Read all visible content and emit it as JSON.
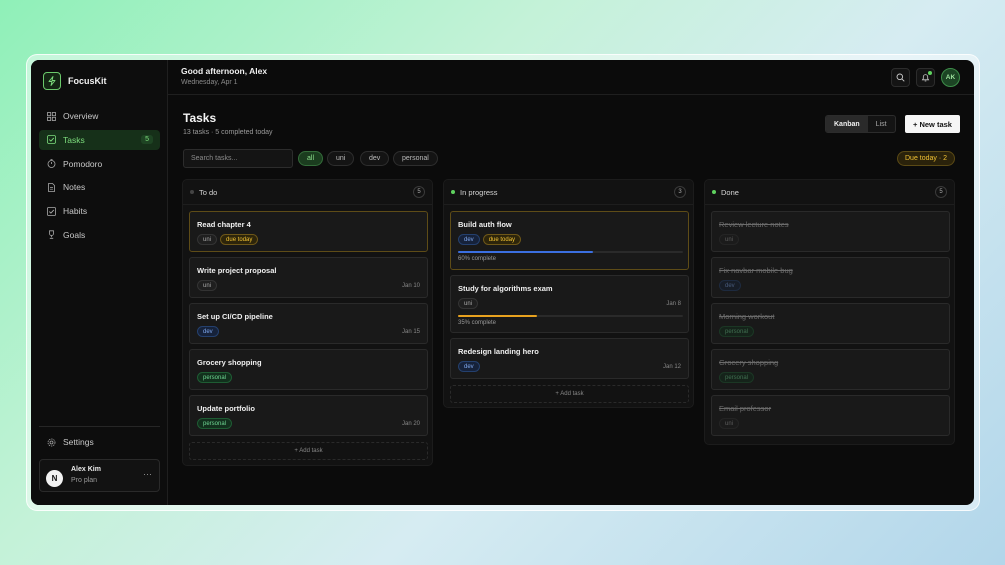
{
  "app": {
    "name": "FocusKit"
  },
  "sidebar": {
    "items": [
      {
        "label": "Overview",
        "icon": "grid-icon"
      },
      {
        "label": "Tasks",
        "icon": "checkbox-icon",
        "badge": "5",
        "active": true
      },
      {
        "label": "Pomodoro",
        "icon": "timer-icon"
      },
      {
        "label": "Notes",
        "icon": "document-icon"
      },
      {
        "label": "Habits",
        "icon": "check-square-icon"
      },
      {
        "label": "Goals",
        "icon": "trophy-icon"
      }
    ],
    "settings_label": "Settings",
    "user": {
      "initial": "N",
      "name": "Alex Kim",
      "plan": "Pro plan",
      "more": "···"
    }
  },
  "topbar": {
    "greeting": "Good afternoon, Alex",
    "date": "Wednesday, Apr 1",
    "avatar_initials": "AK"
  },
  "page": {
    "title": "Tasks",
    "subtitle": "13 tasks · 5 completed today",
    "views": [
      "Kanban",
      "List"
    ],
    "active_view": "Kanban",
    "new_task_label": "+ New task",
    "search_placeholder": "Search tasks...",
    "filters": [
      "all",
      "uni",
      "dev",
      "personal"
    ],
    "active_filter": "all",
    "due_today_label": "Due today · 2"
  },
  "columns": [
    {
      "title": "To do",
      "count": "5",
      "dot_color": "#444444",
      "add_label": "+ Add task",
      "cards": [
        {
          "title": "Read chapter 4",
          "tags": [
            "uni",
            "due today"
          ],
          "date": "",
          "due": true
        },
        {
          "title": "Write project proposal",
          "tags": [
            "uni"
          ],
          "date": "Jan 10"
        },
        {
          "title": "Set up CI/CD pipeline",
          "tags": [
            "dev"
          ],
          "date": "Jan 15"
        },
        {
          "title": "Grocery shopping",
          "tags": [
            "personal"
          ],
          "date": ""
        },
        {
          "title": "Update portfolio",
          "tags": [
            "personal"
          ],
          "date": "Jan 20"
        }
      ]
    },
    {
      "title": "In progress",
      "count": "3",
      "dot_color": "#5fd35f",
      "add_label": "+ Add task",
      "cards": [
        {
          "title": "Build auth flow",
          "tags": [
            "dev",
            "due today"
          ],
          "date": "",
          "due": true,
          "progress": 0.6,
          "progress_color": "#3b6fe0",
          "progress_text": "60% complete"
        },
        {
          "title": "Study for algorithms exam",
          "tags": [
            "uni"
          ],
          "date": "Jan 8",
          "progress": 0.35,
          "progress_color": "#e8a21f",
          "progress_text": "35% complete"
        },
        {
          "title": "Redesign landing hero",
          "tags": [
            "dev"
          ],
          "date": "Jan 12"
        }
      ]
    },
    {
      "title": "Done",
      "count": "5",
      "dot_color": "#5fd35f",
      "cards": [
        {
          "title": "Review lecture notes",
          "tags": [
            "uni"
          ],
          "done": true
        },
        {
          "title": "Fix navbar mobile bug",
          "tags": [
            "dev"
          ],
          "done": true
        },
        {
          "title": "Morning workout",
          "tags": [
            "personal"
          ],
          "done": true
        },
        {
          "title": "Grocery shopping",
          "tags": [
            "personal"
          ],
          "done": true
        },
        {
          "title": "Email professor",
          "tags": [
            "uni"
          ],
          "done": true
        }
      ]
    }
  ]
}
